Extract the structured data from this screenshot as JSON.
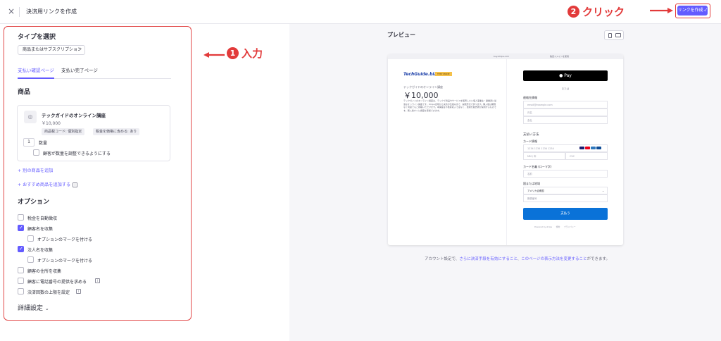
{
  "topbar": {
    "close_icon": "×",
    "title": "決済用リンクを作成",
    "create_button": "リンクを作成 ✓"
  },
  "annotations": {
    "input_num": "1",
    "input_label": "入力",
    "click_num": "2",
    "click_label": "クリック",
    "color": "#e23a3a"
  },
  "left": {
    "heading_type": "タイプを選択",
    "type_select": "商品またはサブスクリプション",
    "tabs": [
      "支払い確認ページ",
      "支払い完了ページ"
    ],
    "products_heading": "商品",
    "product": {
      "name": "テックガイドのオンライン講座",
      "price": "￥10,000",
      "tags": [
        "商品税コード: 個別指定",
        "税金を価格に含める: あり"
      ],
      "quantity": "1",
      "quantity_label": "数量",
      "adjust_label": "顧客が数量を調整できるようにする"
    },
    "add_product_link": "+ 別の商品を追加",
    "add_recommended_link": "+ おすすめ商品を追加する",
    "options_heading": "オプション",
    "options": [
      {
        "label": "税金を自動徴収",
        "checked": false
      },
      {
        "label": "顧客名を収集",
        "checked": true
      },
      {
        "label": "オプションのマークを付ける",
        "checked": false
      },
      {
        "label": "法人名を収集",
        "checked": true
      },
      {
        "label": "オプションのマークを付ける",
        "checked": false
      },
      {
        "label": "顧客の住所を収集",
        "checked": false
      },
      {
        "label": "顧客に電話番号の提供を求める",
        "checked": false
      },
      {
        "label": "決済回数の上限を設定",
        "checked": false
      }
    ],
    "advanced": "詳細設定"
  },
  "preview": {
    "heading": "プレビュー",
    "url": "buy.stripe.com",
    "url2": "独自ドメインを使用",
    "logo": "TechGuide.biz",
    "badge": "TEST MODE",
    "product_name": "テックガイドのオンライン講座",
    "price": "￥10,000",
    "description": "テックガイドのオンライン講座は、テックで商品やサービスを販売したい個人事業主・副業者に最適なオンライン講座です。Stripe活用から決済の仕組みまで、実践形式で学べます。購入後は期限なく何度でもご視聴いただけます。本講座は不動産収入ではなく、技術を販売者が提供するものです。購入後すぐに講座を受講できます。",
    "apple_pay": " Pay",
    "or": "または",
    "contact_label": "連絡先情報",
    "email_ph": "email@example.com",
    "name_ph": "氏名",
    "company_ph": "会社",
    "payment_method": "支払い方法",
    "card_info": "カード情報",
    "card_ph": "1234 1234 1234 1234",
    "expiry_ph": "MM / 年",
    "cvc_ph": "CVC",
    "cardholder": "カード名義 (ローマ字)",
    "cardholder_ph": "名前",
    "country_label": "国または地域",
    "country": "アメリカ合衆国",
    "zip_ph": "郵便番号",
    "pay_button": "支払う",
    "footer": "Powered by stripe　　規約　　プライバシー"
  },
  "footnote": {
    "prefix": "アカウント設定で、",
    "link1": "さらに決済手段を有効にすること",
    "middle": "、",
    "link2": "このページの表示方法を変更すること",
    "suffix": "ができます。"
  },
  "colors": {
    "accent": "#635bff",
    "annotation_red": "#e23a3a",
    "pay_button": "#0a72d8"
  }
}
